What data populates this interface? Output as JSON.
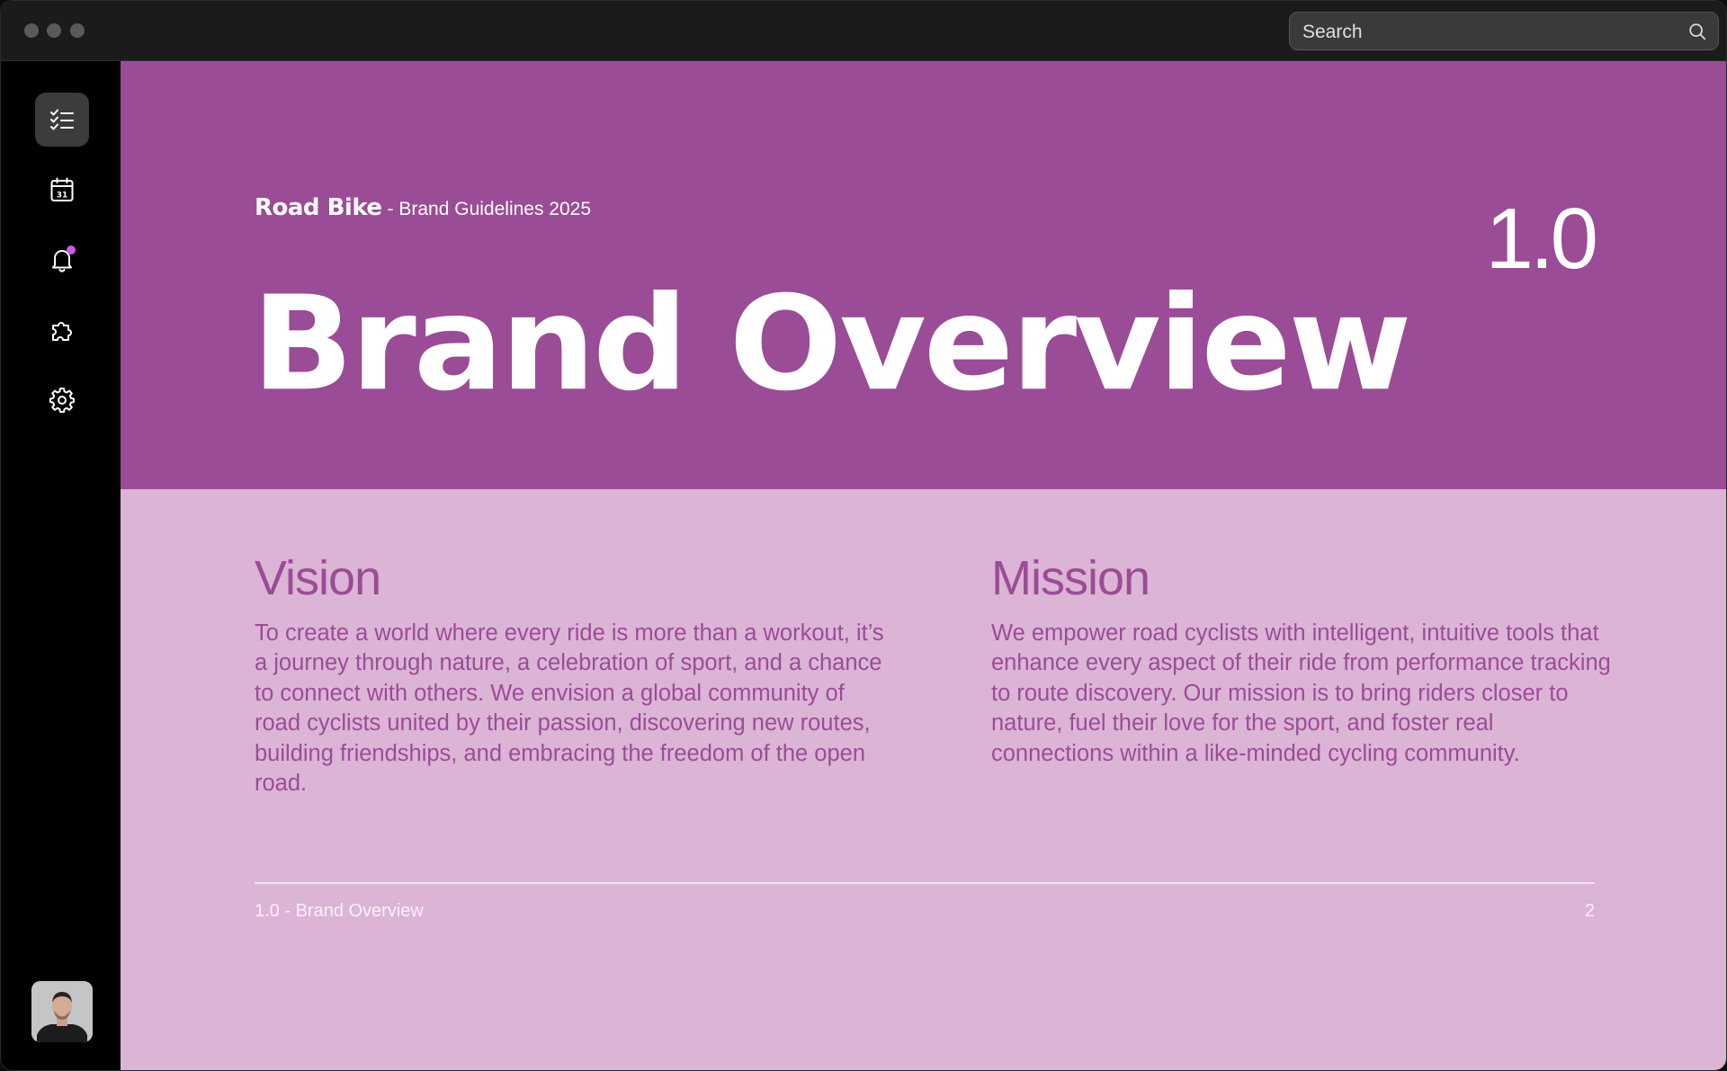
{
  "titlebar": {
    "search": {
      "placeholder": "Search",
      "icon": "search-icon"
    }
  },
  "sidebar": {
    "items": [
      {
        "name": "tasks",
        "icon": "checklist-icon",
        "active": true
      },
      {
        "name": "calendar",
        "icon": "calendar-icon",
        "label": "31"
      },
      {
        "name": "notifications",
        "icon": "bell-icon",
        "has_badge": true
      },
      {
        "name": "extensions",
        "icon": "puzzle-icon"
      },
      {
        "name": "settings",
        "icon": "gear-icon"
      }
    ],
    "avatar": "user-avatar"
  },
  "page": {
    "logo": "Road Bike",
    "subtitle": "- Brand Guidelines 2025",
    "section_number": "1.0",
    "title": "Brand Overview",
    "vision": {
      "heading": "Vision",
      "body": "To create a world where every ride is more than a workout, it’s a journey through nature, a celebration of sport, and a chance to connect with others. We envision a global community of road cyclists united by their passion, discovering new routes, building friendships, and embracing the freedom of the open road."
    },
    "mission": {
      "heading": "Mission",
      "body": "We empower road cyclists with intelligent, intuitive tools that enhance every aspect of their ride from performance tracking to route discovery. Our mission is to bring riders closer to nature, fuel their love for the sport, and foster real connections within a like-minded cycling community."
    },
    "footer": {
      "label": "1.0 - Brand Overview",
      "page_number": "2"
    }
  },
  "colors": {
    "hero_bg": "#9b4c96",
    "body_bg": "#dcb4d6",
    "accent_text": "#9b4c96",
    "notification_dot": "#c25ee0"
  }
}
